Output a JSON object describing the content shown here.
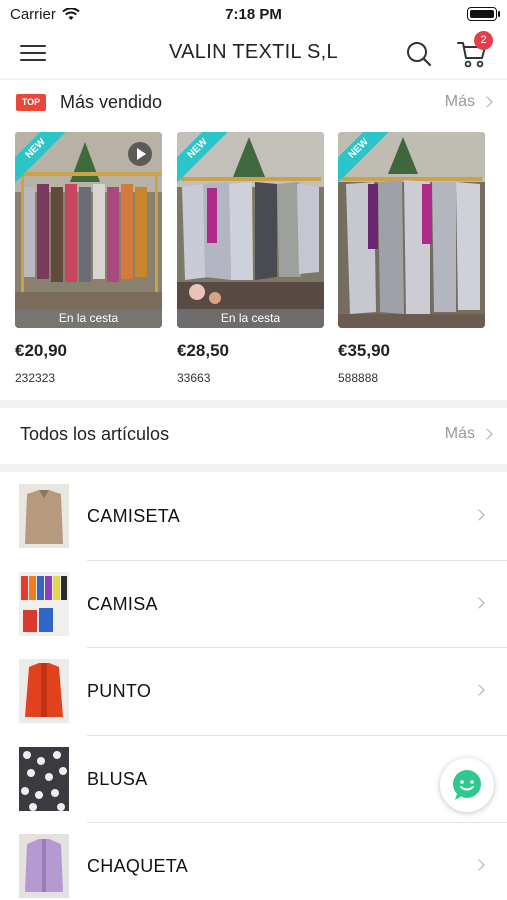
{
  "status_bar": {
    "carrier": "Carrier",
    "time": "7:18 PM"
  },
  "nav": {
    "title": "VALIN TEXTIL S,L",
    "cart_count": "2",
    "icons": [
      "menu-icon",
      "search-icon",
      "cart-icon"
    ]
  },
  "best_sellers": {
    "badge": "TOP",
    "title": "Más vendido",
    "more": "Más",
    "products": [
      {
        "price": "€20,90",
        "code": "232323",
        "ribbon": "NEW",
        "status": "En la cesta",
        "has_video": true
      },
      {
        "price": "€28,50",
        "code": "33663",
        "ribbon": "NEW",
        "status": "En la cesta",
        "has_video": false
      },
      {
        "price": "€35,90",
        "code": "588888",
        "ribbon": "NEW",
        "status": "",
        "has_video": false
      }
    ]
  },
  "all_items": {
    "title": "Todos los artículos",
    "more": "Más",
    "categories": [
      {
        "label": "CAMISETA"
      },
      {
        "label": "CAMISA"
      },
      {
        "label": "PUNTO"
      },
      {
        "label": "BLUSA"
      },
      {
        "label": "CHAQUETA"
      }
    ]
  },
  "colors": {
    "accent_red": "#e63c4b",
    "new_ribbon": "#2bc4c9",
    "chat_green": "#2ec98e"
  }
}
